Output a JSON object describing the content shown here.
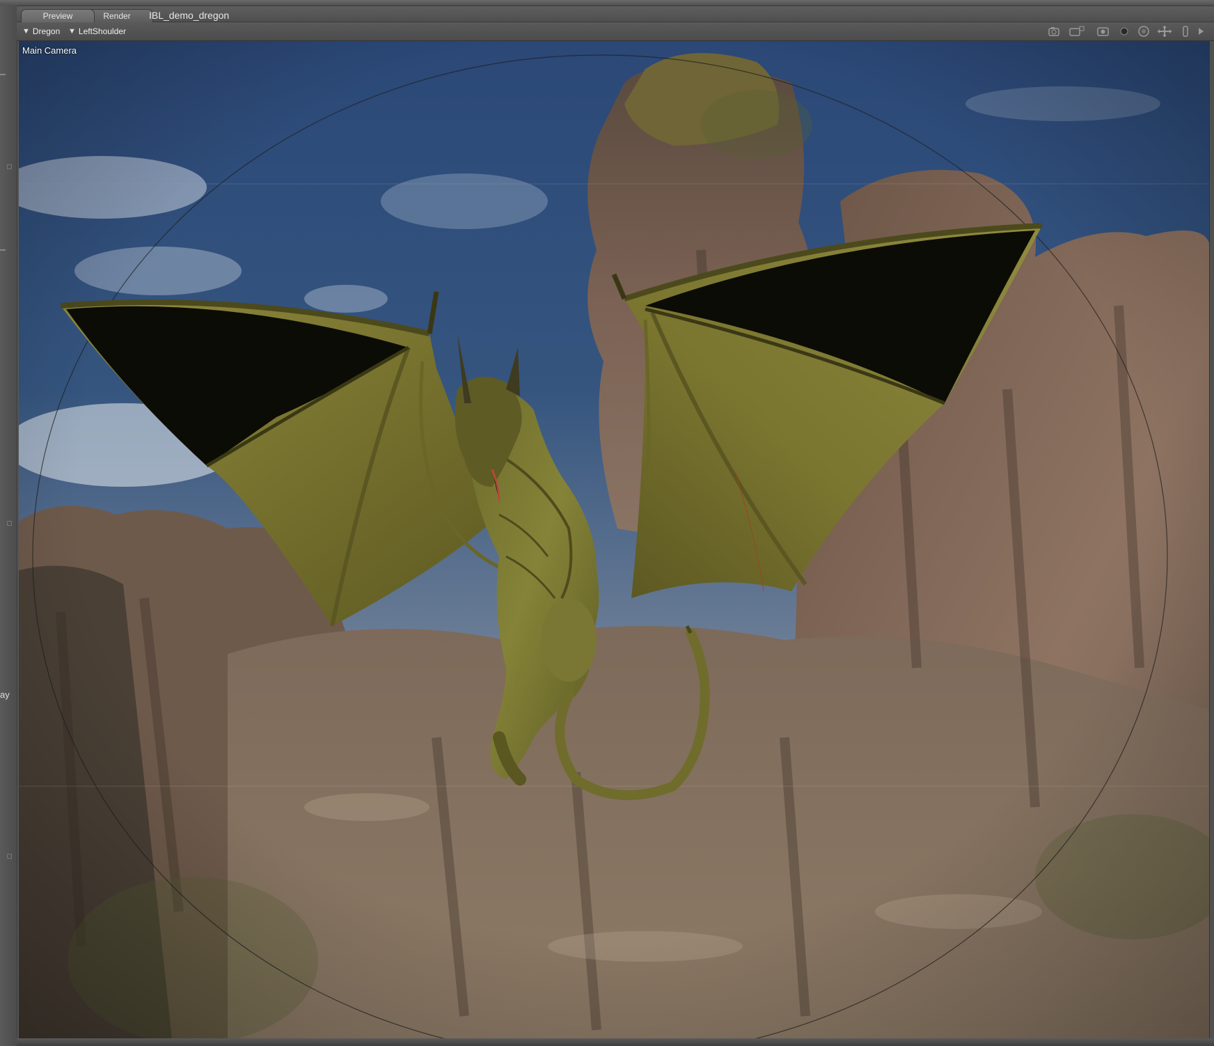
{
  "tabs": [
    {
      "label": "Preview",
      "active": true
    },
    {
      "label": "Render",
      "active": false
    }
  ],
  "document_title": "IBL_demo_dregon",
  "toolbar": {
    "figure_selector": "Dregon",
    "bone_selector": "LeftShoulder",
    "icons": [
      "camera-icon",
      "camera-aux-icon",
      "render-icon",
      "sphere-icon",
      "orbit-icon",
      "move-icon",
      "scale-icon",
      "more-icon"
    ]
  },
  "viewport": {
    "camera_label": "Main Camera"
  },
  "side_panel": {
    "cut_label": "ay"
  },
  "colors": {
    "sky": "#2f4d7a",
    "rock": "#7a6050",
    "dragon_skin": "#7d7a30",
    "ui_dark": "#4c4c4c"
  }
}
